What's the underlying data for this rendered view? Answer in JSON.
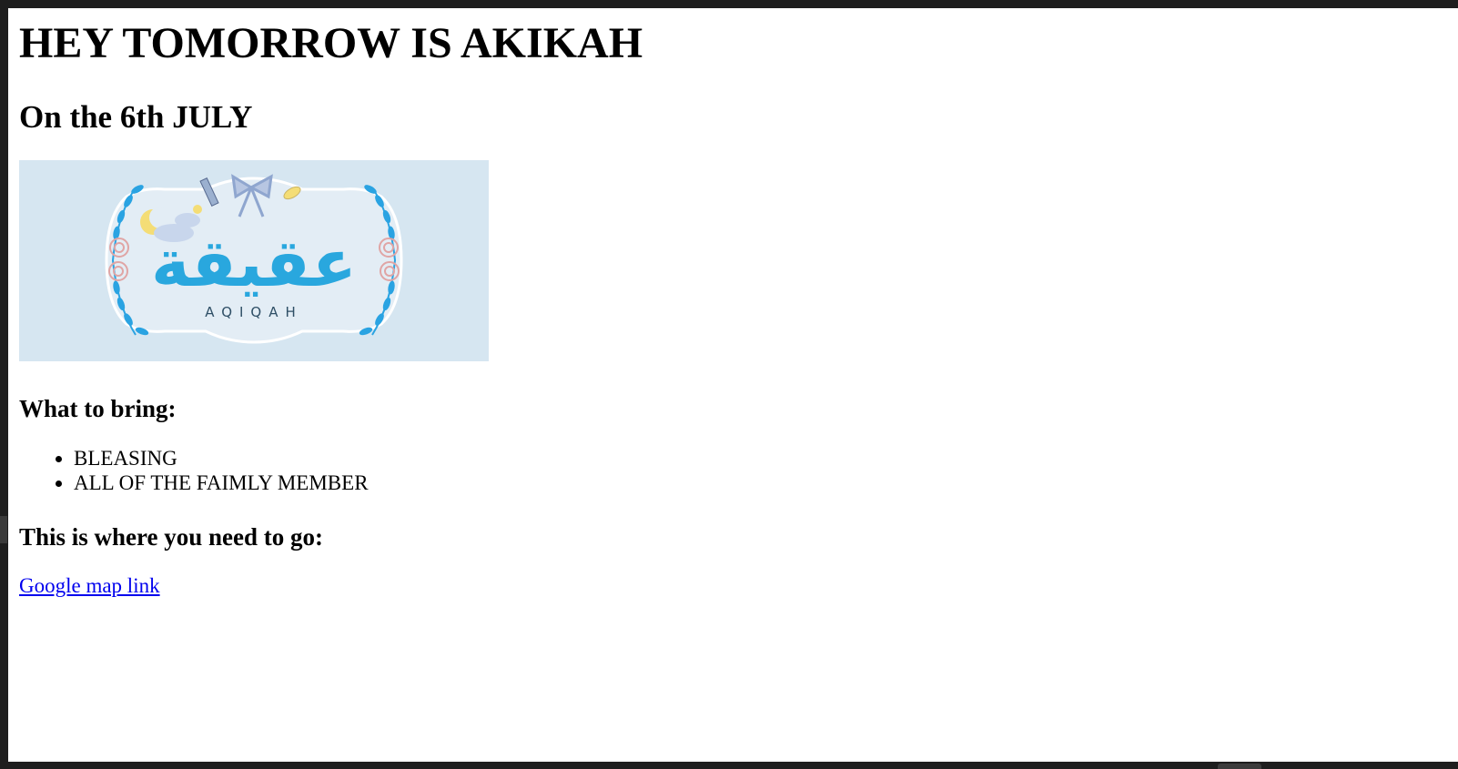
{
  "page": {
    "title": "HEY TOMORROW IS AKIKAH",
    "subtitle": "On the 6th JULY",
    "banner": {
      "caption": "AQIQAH",
      "arabic_text": "عقيقة",
      "colors": {
        "background": "#d6e6f1",
        "plaque": "#e2edf5",
        "leaves": "#2aa3e2",
        "script": "#29a7de",
        "roses": "#e0a5a5",
        "moon": "#f4dd76"
      }
    },
    "bring_heading": "What to bring:",
    "bring_items": [
      "BLEASING",
      "ALL OF THE FAIMLY MEMBER"
    ],
    "where_heading": "This is where you need to go:",
    "map_link_text": "Google map link",
    "link_color": "#0000ee"
  }
}
